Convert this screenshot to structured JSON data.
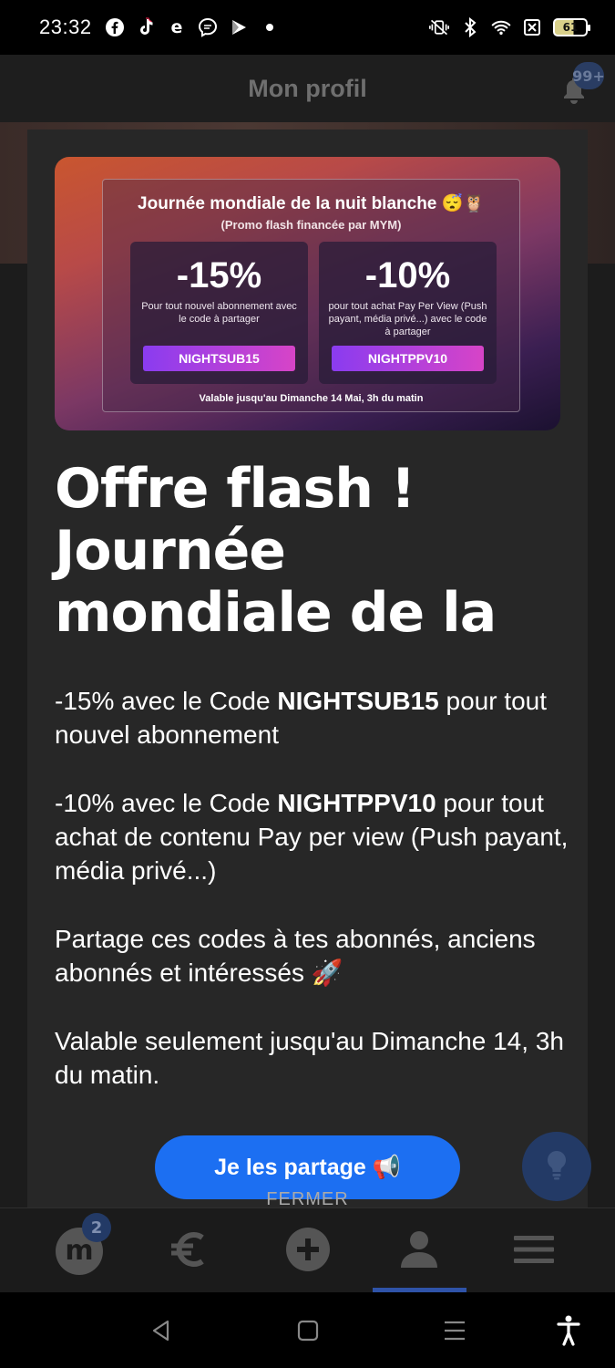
{
  "status_bar": {
    "time": "23:32",
    "left_icons": [
      "facebook-icon",
      "tiktok-icon",
      "e-icon",
      "messenger-icon",
      "play-icon",
      "dot-icon"
    ],
    "right_icons": [
      "vibrate-icon",
      "bluetooth-icon",
      "wifi-icon",
      "no-sim-icon"
    ],
    "battery": "61"
  },
  "header": {
    "title": "Mon profil",
    "notification_badge": "99+"
  },
  "modal": {
    "banner": {
      "title": "Journée mondiale de la nuit blanche 😴🦉",
      "subtitle": "(Promo flash financée par MYM)",
      "promos": [
        {
          "percent": "-15%",
          "description": "Pour tout nouvel abonnement avec le code à partager",
          "code": "NIGHTSUB15"
        },
        {
          "percent": "-10%",
          "description": "pour tout achat Pay Per View (Push payant, média privé...) avec le code à partager",
          "code": "NIGHTPPV10"
        }
      ],
      "validity": "Valable jusqu'au Dimanche 14 Mai, 3h du matin"
    },
    "title": "Offre flash ! Journée mondiale de la",
    "paragraphs": [
      {
        "before": "-15% avec le Code ",
        "code": "NIGHTSUB15",
        "after": " pour tout nouvel abonnement"
      },
      {
        "before": "-10% avec le Code ",
        "code": "NIGHTPPV10",
        "after": " pour tout achat de contenu Pay per view (Push payant, média privé...)"
      },
      {
        "before": "Partage ces codes à tes abonnés, anciens abonnés et intéressés 🚀",
        "code": "",
        "after": ""
      },
      {
        "before": "Valable seulement jusqu'au Dimanche 14, 3h du matin.",
        "code": "",
        "after": ""
      }
    ],
    "share_button": "Je les partage 📢",
    "close_button": "FERMER"
  },
  "bottom_nav": {
    "items": [
      {
        "name": "nav-mym",
        "label": "m",
        "badge": "2"
      },
      {
        "name": "nav-euro",
        "label": "€"
      },
      {
        "name": "nav-add",
        "label": "+"
      },
      {
        "name": "nav-profile",
        "label": ""
      },
      {
        "name": "nav-menu",
        "label": ""
      }
    ],
    "active_index": 3
  },
  "colors": {
    "accent": "#1c6ff2",
    "modal_bg": "#272727",
    "badge": "#233a66"
  }
}
